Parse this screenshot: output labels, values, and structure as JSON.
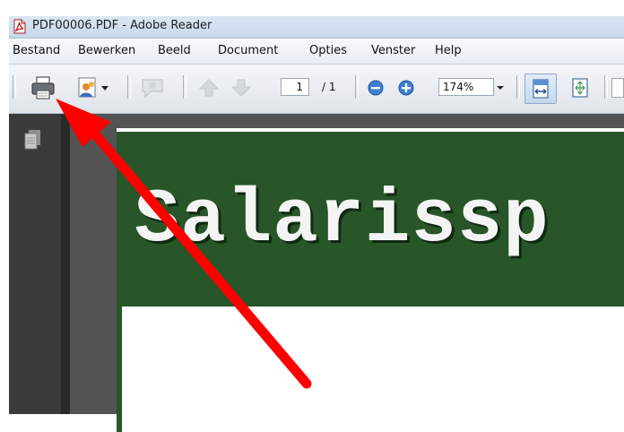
{
  "window": {
    "title": "PDF00006.PDF - Adobe Reader"
  },
  "menu": {
    "items": [
      {
        "label": "Bestand"
      },
      {
        "label": "Bewerken"
      },
      {
        "label": "Beeld"
      },
      {
        "label": "Document"
      },
      {
        "label": "Opties"
      },
      {
        "label": "Venster"
      },
      {
        "label": "Help"
      }
    ]
  },
  "toolbar": {
    "page_current": "1",
    "page_total": "/ 1",
    "zoom": "174%"
  },
  "document": {
    "banner_text": "Salarissp"
  },
  "colors": {
    "banner": "#285628",
    "arrow": "#ff0000"
  },
  "icons": [
    "pdf-file-icon",
    "print-icon",
    "collaborate-icon",
    "dropdown-arrow-icon",
    "comment-icon",
    "arrow-up-icon",
    "arrow-down-icon",
    "zoom-out-icon",
    "zoom-in-icon",
    "fit-width-icon",
    "fit-page-icon",
    "pages-icon"
  ]
}
